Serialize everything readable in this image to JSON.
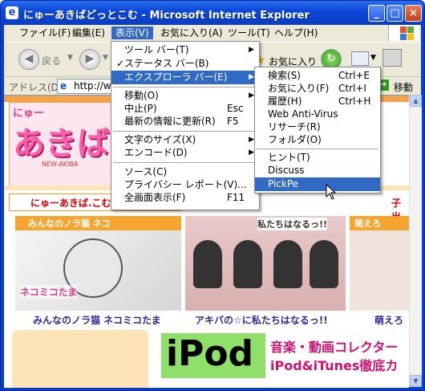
{
  "window": {
    "title": "にゅーあきばどっとこむ - Microsoft Internet Explorer",
    "min": "_",
    "max": "□",
    "close": "×"
  },
  "menubar": [
    "ファイル(F)",
    "編集(E)",
    "表示(V)",
    "お気に入り(A)",
    "ツール(T)",
    "ヘルプ(H)"
  ],
  "toolbar": {
    "back": "戻る",
    "favorites": "お気に入り",
    "go": "移動"
  },
  "address": {
    "label": "アドレス(D)",
    "value": "http://w"
  },
  "view_menu": {
    "items": [
      {
        "label": "ツール バー(T)",
        "submenu": true
      },
      {
        "label": "ステータス バー(B)",
        "checked": true
      },
      {
        "label": "エクスプローラ バー(E)",
        "submenu": true,
        "highlighted": true
      },
      {
        "sep": true
      },
      {
        "label": "移動(O)",
        "submenu": true
      },
      {
        "label": "中止(P)",
        "shortcut": "Esc"
      },
      {
        "label": "最新の情報に更新(R)",
        "shortcut": "F5"
      },
      {
        "sep": true
      },
      {
        "label": "文字のサイズ(X)",
        "submenu": true
      },
      {
        "label": "エンコード(D)",
        "submenu": true
      },
      {
        "sep": true
      },
      {
        "label": "ソース(C)"
      },
      {
        "label": "プライバシー レポート(V)..."
      },
      {
        "label": "全画面表示(F)",
        "shortcut": "F11"
      }
    ]
  },
  "explorer_bar_menu": {
    "items": [
      {
        "label": "検索(S)",
        "shortcut": "Ctrl+E"
      },
      {
        "label": "お気に入り(F)",
        "shortcut": "Ctrl+I"
      },
      {
        "label": "履歴(H)",
        "shortcut": "Ctrl+H"
      },
      {
        "label": "Web Anti-Virus"
      },
      {
        "label": "リサーチ(R)"
      },
      {
        "label": "フォルダ(O)"
      },
      {
        "sep": true
      },
      {
        "label": "ヒント(T)"
      },
      {
        "label": "Discuss"
      },
      {
        "label": "PickPe",
        "highlighted": true
      }
    ]
  },
  "page": {
    "logo_top": "にゅー",
    "logo_main": "あきば",
    "logo_sub": "NEW-AKIBA",
    "site_link": "にゅーあきば.こむ",
    "cards": [
      {
        "header": "みんなのノラ猫 ネコ",
        "caption": "みんなのノラ猫 ネコミコたま"
      },
      {
        "header": "",
        "caption": "アキバの☆に私たちはなるっ!!"
      },
      {
        "header": "萌えろ",
        "caption": "萌えろ"
      }
    ],
    "card2_overlay": "私たちはなるっ!!",
    "card1_overlay": "ネコミコたま",
    "right_link": "子出",
    "ipod_text": "iPod",
    "ipod_line1": "音楽・動画コレクター",
    "ipod_line2": "iPod&iTunes徹底カ"
  }
}
